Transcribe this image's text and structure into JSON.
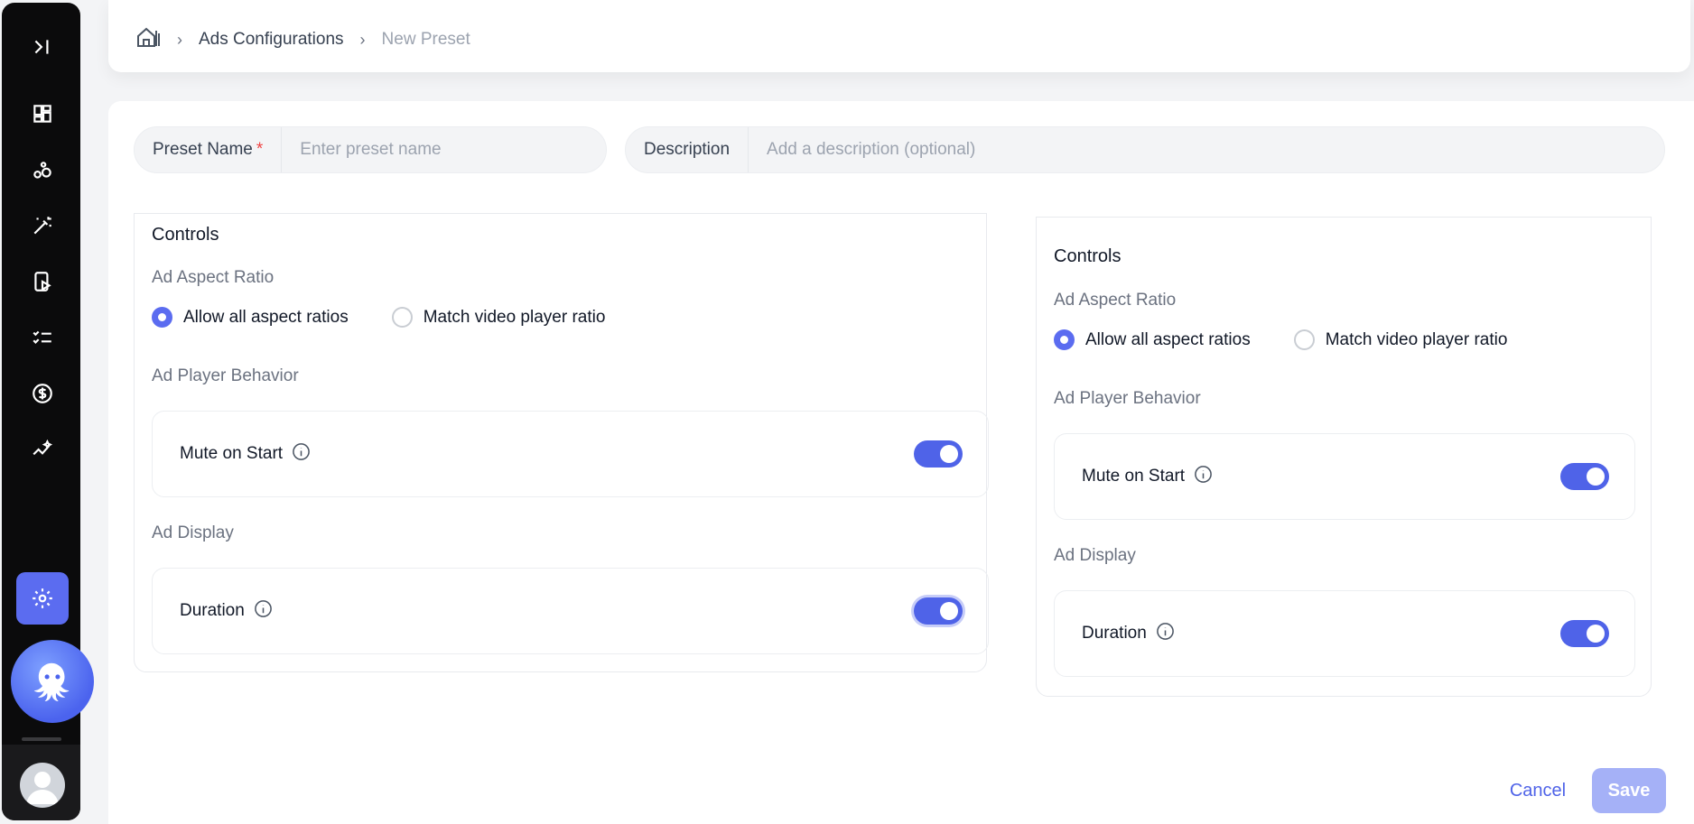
{
  "breadcrumb": {
    "home_icon": "home-icon",
    "items": [
      "Ads Configurations",
      "New Preset"
    ]
  },
  "form": {
    "preset_name": {
      "label": "Preset Name",
      "required_mark": "*",
      "placeholder": "Enter preset name",
      "value": ""
    },
    "description": {
      "label": "Description",
      "placeholder": "Add a description (optional)",
      "value": ""
    }
  },
  "panels": [
    {
      "title": "Controls",
      "aspect_ratio": {
        "label": "Ad Aspect Ratio",
        "options": [
          "Allow all aspect ratios",
          "Match video player ratio"
        ],
        "selected": "Allow all aspect ratios"
      },
      "player_behavior": {
        "label": "Ad Player Behavior",
        "toggle_label": "Mute on Start",
        "toggle_on": true
      },
      "display": {
        "label": "Ad Display",
        "toggle_label": "Duration",
        "toggle_on": true
      }
    },
    {
      "title": "Controls",
      "aspect_ratio": {
        "label": "Ad Aspect Ratio",
        "options": [
          "Allow all aspect ratios",
          "Match video player ratio"
        ],
        "selected": "Allow all aspect ratios"
      },
      "player_behavior": {
        "label": "Ad Player Behavior",
        "toggle_label": "Mute on Start",
        "toggle_on": true
      },
      "display": {
        "label": "Ad Display",
        "toggle_label": "Duration",
        "toggle_on": true
      }
    }
  ],
  "actions": {
    "cancel_label": "Cancel",
    "save_label": "Save"
  },
  "colors": {
    "accent": "#4f63e8",
    "save_disabled": "#a5b1f7"
  }
}
